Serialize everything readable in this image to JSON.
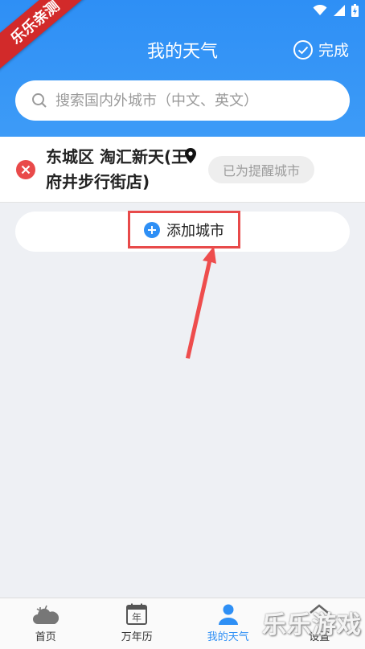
{
  "header": {
    "title": "我的天气",
    "done_label": "完成"
  },
  "search": {
    "placeholder": "搜索国内外城市（中文、英文）"
  },
  "city": {
    "name": "东城区 淘汇新天(王府井步行街店)",
    "remind_label": "已为提醒城市"
  },
  "add_city": {
    "label": "添加城市"
  },
  "badge": {
    "text": "乐乐亲测"
  },
  "tabs": [
    {
      "label": "首页",
      "icon": "cloud-icon"
    },
    {
      "label": "万年历",
      "icon": "calendar-icon",
      "icon_text": "年"
    },
    {
      "label": "我的天气",
      "icon": "person-icon"
    },
    {
      "label": "设置",
      "icon": "settings-icon"
    }
  ],
  "watermark": {
    "text": "乐乐游戏"
  },
  "colors": {
    "header_blue": "#2e8ff5",
    "remove_red": "#e94a4a",
    "highlight_red": "#e84a4a"
  }
}
